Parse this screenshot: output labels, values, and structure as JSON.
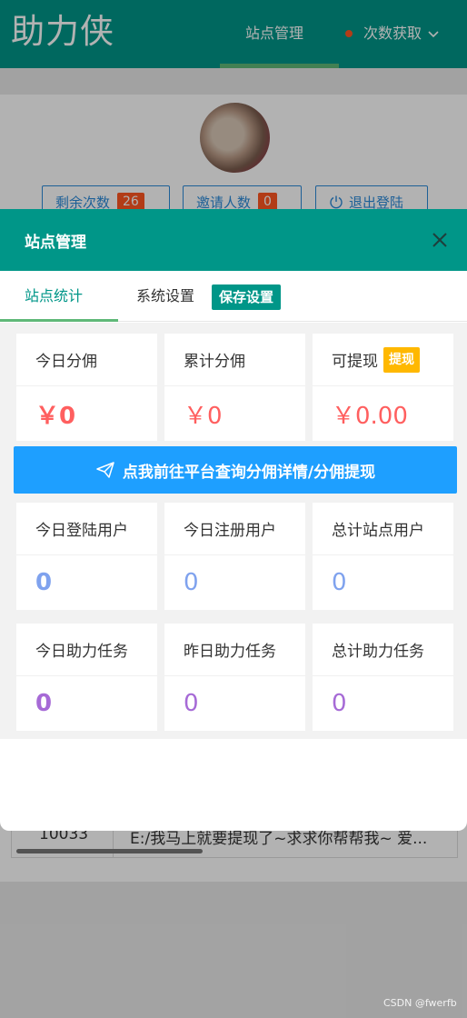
{
  "app": {
    "title": "助力侠"
  },
  "nav": {
    "station_manage": "站点管理",
    "count_fetch": "次数获取"
  },
  "profile": {
    "remaining_label": "剩余次数",
    "remaining_value": "26",
    "invite_label": "邀请人数",
    "invite_value": "0",
    "logout_label": "退出登陆"
  },
  "bg_table": {
    "id": "10033",
    "text": "E:/我马上就要提现了~求求你帮帮我~ 爱..."
  },
  "modal": {
    "title": "站点管理",
    "tabs": {
      "stats": "站点统计",
      "settings": "系统设置",
      "save": "保存设置"
    },
    "commission": [
      {
        "label": "今日分佣",
        "value": "￥0"
      },
      {
        "label": "累计分佣",
        "value": "￥0"
      },
      {
        "label": "可提现",
        "value": "￥0.00",
        "action": "提现"
      }
    ],
    "link_button": "点我前往平台查询分佣详情/分佣提现",
    "users": [
      {
        "label": "今日登陆用户",
        "value": "0"
      },
      {
        "label": "今日注册用户",
        "value": "0"
      },
      {
        "label": "总计站点用户",
        "value": "0"
      }
    ],
    "tasks": [
      {
        "label": "今日助力任务",
        "value": "0"
      },
      {
        "label": "昨日助力任务",
        "value": "0"
      },
      {
        "label": "总计助力任务",
        "value": "0"
      }
    ]
  },
  "watermark": "CSDN @fwerfb",
  "colors": {
    "primary": "#009688",
    "accent": "#5fb878",
    "danger": "#ff5722",
    "warn": "#ffb800",
    "link": "#1e9fff"
  },
  "icons": {
    "close": "close-icon",
    "dropdown": "chevron-down-icon",
    "logout": "power-icon",
    "send": "paper-plane-icon"
  }
}
